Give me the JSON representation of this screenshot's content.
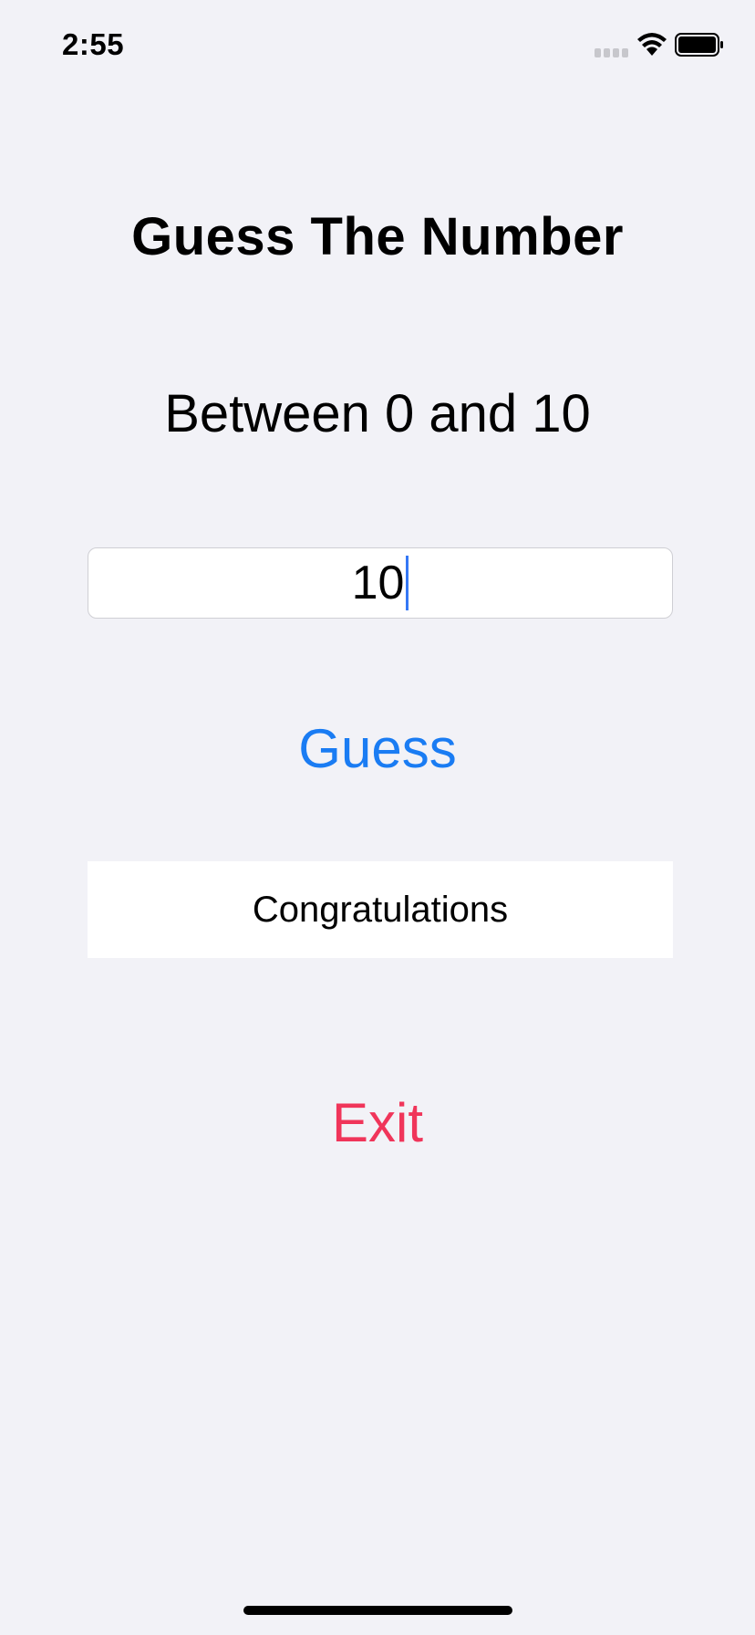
{
  "status_bar": {
    "time": "2:55"
  },
  "icons": {
    "signal": "cellular-signal-icon",
    "wifi": "wifi-icon",
    "battery": "battery-icon"
  },
  "screen": {
    "title": "Guess The Number",
    "subtitle": "Between 0 and 10",
    "input_value": "10",
    "guess_label": "Guess",
    "result_text": "Congratulations",
    "exit_label": "Exit"
  },
  "colors": {
    "background": "#f2f2f7",
    "accent_blue": "#1a7cf3",
    "destructive_red": "#f0355a"
  }
}
